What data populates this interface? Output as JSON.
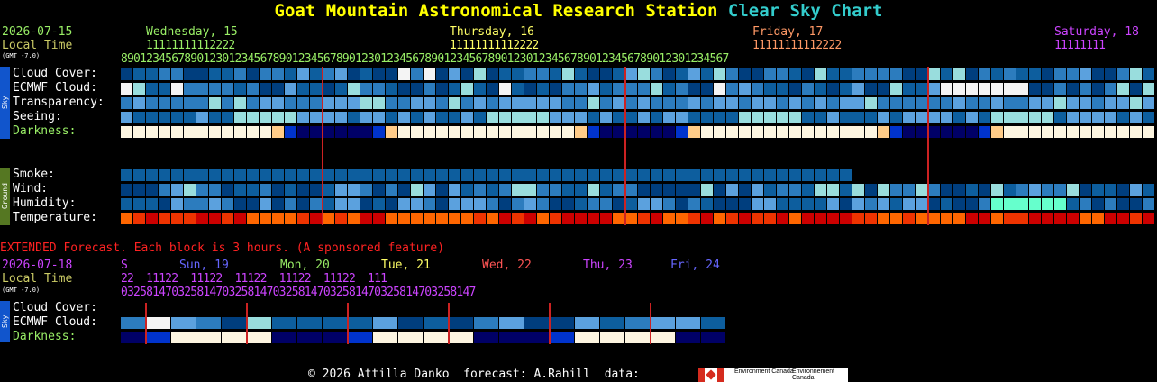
{
  "title": {
    "part1": "Goat Mountain Astronomical Research Station",
    "part2": "Clear Sky Chart"
  },
  "date": "2026-07-15",
  "local_time": "Local Time",
  "gmt": "(GMT -7.0)",
  "days": [
    {
      "name": "Wednesday, 15",
      "color": "#99ee66"
    },
    {
      "name": "Thursday, 16",
      "color": "#ffff66"
    },
    {
      "name": "Friday, 17",
      "color": "#ff9966"
    },
    {
      "name": "Saturday, 18",
      "color": "#cc44ff"
    }
  ],
  "hour_tens": [
    "11111111112222",
    "11111111112222",
    "11111111112222",
    "11111111"
  ],
  "hour_ones": [
    "890123456789012301234567890123456789012301234567890123456789012301234567890123456789012301234567"
  ],
  "sky_label": "Sky",
  "ground_label": "Ground",
  "sky_rows": [
    "Cloud Cover:",
    "ECMWF Cloud:",
    "Transparency:",
    "Seeing:",
    "Darkness:"
  ],
  "ground_rows": [
    "Smoke:",
    "Wind:",
    "Humidity:",
    "Temperature:"
  ],
  "extended": {
    "heading": "EXTENDED Forecast. Each block is 3 hours. (A sponsored feature)",
    "date": "2026-07-18",
    "days": [
      {
        "name": "S",
        "color": "#cc44ff"
      },
      {
        "name": "Sun, 19",
        "color": "#6666ff"
      },
      {
        "name": "Mon, 20",
        "color": "#99ee66"
      },
      {
        "name": "Tue, 21",
        "color": "#ffff66"
      },
      {
        "name": "Wed, 22",
        "color": "#ff5555"
      },
      {
        "name": "Thu, 23",
        "color": "#cc44ff"
      },
      {
        "name": "Fri, 24",
        "color": "#6666ff"
      }
    ],
    "hour_tens": "22  11122  11122  11122  11122  11122  111",
    "hour_ones": "03258147032581470325814703258147032581470325814703258147",
    "rows": [
      "Cloud Cover:",
      "ECMWF Cloud:",
      "Darkness:"
    ]
  },
  "footer": {
    "copyright": "© 2026 Attilla Danko  forecast: A.Rahill  data:",
    "logo1": "Environment Canada",
    "logo2": "Environnement Canada"
  },
  "colors": {
    "deep_blue": "#003e7e",
    "blue": "#0d5e9e",
    "mid_blue": "#2c7cbe",
    "light_blue": "#5ba1de",
    "sky_blue": "#7ec0ee",
    "cyan_light": "#99dddd",
    "white": "#f4f4f4",
    "grey": "#c8c8c8",
    "red": "#cc0000",
    "orange": "#ff6600",
    "divider_red": "#cc2222"
  }
}
